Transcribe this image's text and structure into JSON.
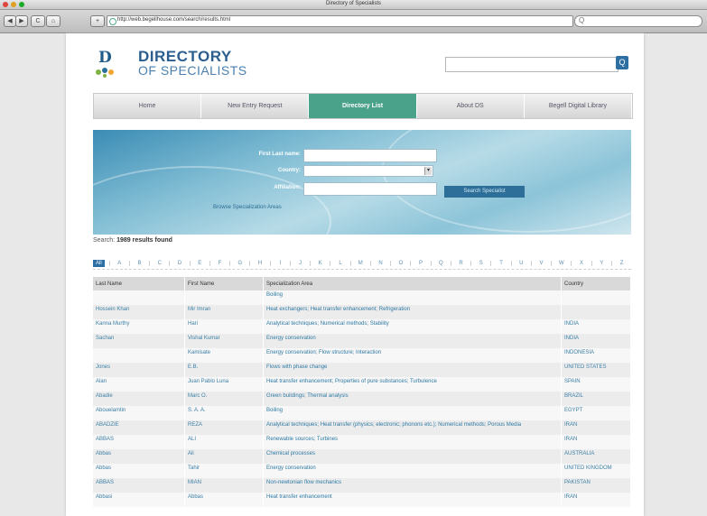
{
  "window": {
    "title": "Directory of Specialists"
  },
  "browser": {
    "url": "http://web.begellhouse.com/search/results.html",
    "back": "◀",
    "forward": "▶",
    "reload": "C",
    "home": "⌂",
    "add": "+",
    "search_glyph": "Q"
  },
  "site": {
    "logo_letter": "D",
    "title_line1": "DIRECTORY",
    "title_line2": "OF SPECIALISTS",
    "search_placeholder": "",
    "search_button": "Q"
  },
  "nav": [
    {
      "label": "Home",
      "active": false
    },
    {
      "label": "New Entry Request",
      "active": false
    },
    {
      "label": "Directory List",
      "active": true
    },
    {
      "label": "About DS",
      "active": false
    },
    {
      "label": "Begell Digital Library",
      "active": false
    }
  ],
  "form": {
    "last_name_label": "First Last name:",
    "country_label": "Country:",
    "affiliation_label": "Affiliation:",
    "submit_label": "Search Specialist",
    "browse_link": "Browse Specialization Areas"
  },
  "results": {
    "prefix": "Search:",
    "count_text": "1989 results found"
  },
  "alphabet": {
    "all_label": "All",
    "letters": [
      "A",
      "B",
      "C",
      "D",
      "E",
      "F",
      "G",
      "H",
      "I",
      "J",
      "K",
      "L",
      "M",
      "N",
      "O",
      "P",
      "Q",
      "R",
      "S",
      "T",
      "U",
      "V",
      "W",
      "X",
      "Y",
      "Z"
    ]
  },
  "table": {
    "headers": [
      "Last Name",
      "First Name",
      "Specialization Area",
      "Country"
    ],
    "rows": [
      [
        "",
        "",
        "Boiling",
        ""
      ],
      [
        "Hossein Khan",
        "Mir Imran",
        "Heat exchangers; Heat transfer enhancement; Refrigeration",
        ""
      ],
      [
        "Kanna Murthy",
        "Hari",
        "Analytical techniques; Numerical methods; Stability",
        "INDIA"
      ],
      [
        "Sachan",
        "Vishal Kumar",
        "Energy conservation",
        "INDIA"
      ],
      [
        "",
        "Kamisate",
        "Energy conservation; Flow structure; Interaction",
        "INDONESIA"
      ],
      [
        "Jones",
        "E.B.",
        "Flows with phase change",
        "UNITED STATES"
      ],
      [
        "Alan",
        "Juan Pablo Luna",
        "Heat transfer enhancement; Properties of pure substances; Turbulence",
        "SPAIN"
      ],
      [
        "Abadie",
        "Marc O.",
        "Green buildings; Thermal analysis",
        "BRAZIL"
      ],
      [
        "Abouelamtin",
        "S. A. A.",
        "Boiling",
        "EGYPT"
      ],
      [
        "ABADZIE",
        "REZA",
        "Analytical techniques; Heat transfer (physics; electronic; phonons etc.); Numerical methods; Porous Media",
        "IRAN"
      ],
      [
        "ABBAS",
        "ALI",
        "Renewable sources; Turbines",
        "IRAN"
      ],
      [
        "Abbas",
        "Ali",
        "Chemical processes",
        "AUSTRALIA"
      ],
      [
        "Abbas",
        "Tahir",
        "Energy conservation",
        "UNITED KINGDOM"
      ],
      [
        "ABBAS",
        "MIAN",
        "Non-newtonian flow mechanics",
        "PAKISTAN"
      ],
      [
        "Abbasi",
        "Abbas",
        "Heat transfer enhancement",
        "IRAN"
      ]
    ]
  }
}
